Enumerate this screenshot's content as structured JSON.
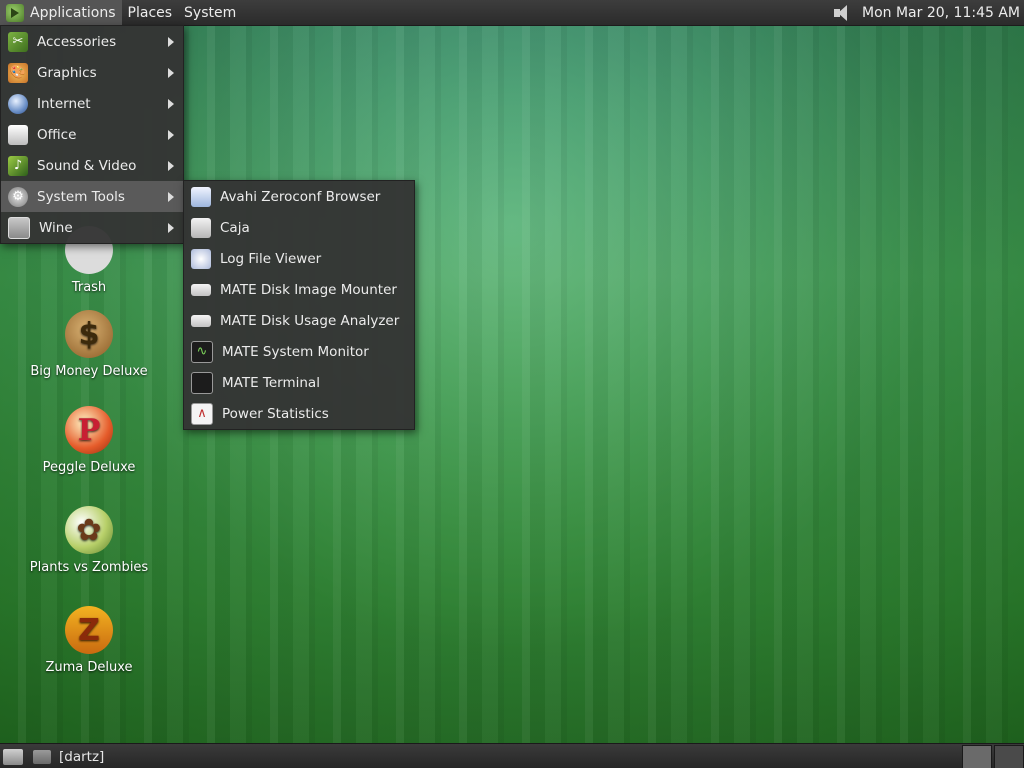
{
  "top_panel": {
    "applications": "Applications",
    "places": "Places",
    "system": "System",
    "clock": "Mon Mar 20, 11:45 AM"
  },
  "desktop_icons": [
    {
      "label": "Trash",
      "icon": "trash-icon"
    },
    {
      "label": "Big Money Deluxe",
      "icon": "money-bag-icon",
      "glyph": "$"
    },
    {
      "label": "Peggle Deluxe",
      "icon": "peggle-icon",
      "glyph": "P"
    },
    {
      "label": "Plants vs Zombies",
      "icon": "plants-vs-zombies-icon",
      "glyph": "✿"
    },
    {
      "label": "Zuma Deluxe",
      "icon": "zuma-icon",
      "glyph": "Z"
    }
  ],
  "applications_menu": {
    "items": [
      {
        "label": "Accessories",
        "icon": "accessories-icon"
      },
      {
        "label": "Graphics",
        "icon": "graphics-icon"
      },
      {
        "label": "Internet",
        "icon": "internet-icon"
      },
      {
        "label": "Office",
        "icon": "office-icon"
      },
      {
        "label": "Sound & Video",
        "icon": "sound-video-icon"
      },
      {
        "label": "System Tools",
        "icon": "system-tools-icon",
        "highlighted": true
      },
      {
        "label": "Wine",
        "icon": "wine-icon"
      }
    ]
  },
  "system_tools_menu": {
    "items": [
      {
        "label": "Avahi Zeroconf Browser",
        "icon": "avahi-icon"
      },
      {
        "label": "Caja",
        "icon": "caja-icon"
      },
      {
        "label": "Log File Viewer",
        "icon": "log-viewer-icon"
      },
      {
        "label": "MATE Disk Image Mounter",
        "icon": "disk-image-icon"
      },
      {
        "label": "MATE Disk Usage Analyzer",
        "icon": "disk-usage-icon"
      },
      {
        "label": "MATE System Monitor",
        "icon": "system-monitor-icon"
      },
      {
        "label": "MATE Terminal",
        "icon": "terminal-icon"
      },
      {
        "label": "Power Statistics",
        "icon": "power-statistics-icon"
      }
    ]
  },
  "bottom_panel": {
    "task_label": "[dartz]"
  }
}
